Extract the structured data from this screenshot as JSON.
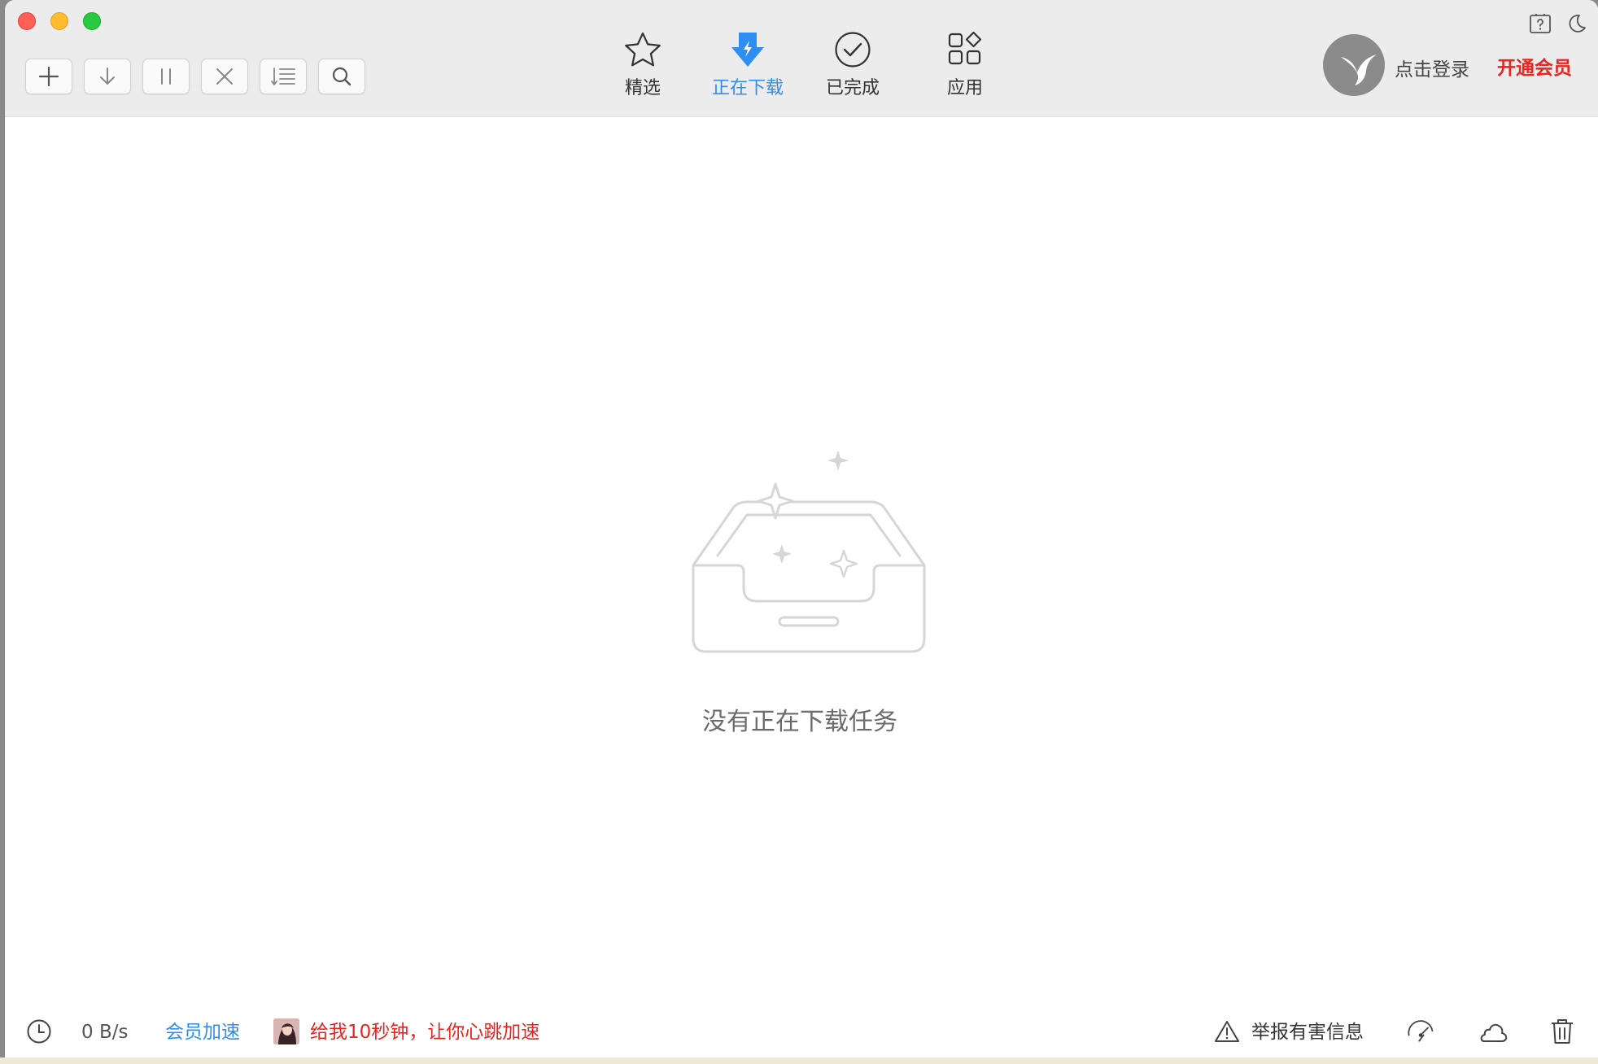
{
  "toolbar": {
    "buttons": [
      {
        "name": "add-task-button",
        "icon": "plus-icon"
      },
      {
        "name": "start-download-button",
        "icon": "arrow-down-icon"
      },
      {
        "name": "pause-button",
        "icon": "pause-icon"
      },
      {
        "name": "delete-task-button",
        "icon": "close-icon"
      },
      {
        "name": "sort-button",
        "icon": "sort-list-icon"
      },
      {
        "name": "search-button",
        "icon": "search-icon"
      }
    ]
  },
  "nav": {
    "tabs": [
      {
        "label": "精选",
        "icon": "star-icon",
        "active": false
      },
      {
        "label": "正在下载",
        "icon": "download-bolt-icon",
        "active": true
      },
      {
        "label": "已完成",
        "icon": "check-circle-icon",
        "active": false
      },
      {
        "label": "应用",
        "icon": "apps-grid-icon",
        "active": false
      }
    ]
  },
  "account": {
    "login_text": "点击登录",
    "vip_text": "开通会员",
    "help_icon": "help-icon",
    "theme_icon": "moon-icon"
  },
  "main": {
    "empty_message": "没有正在下载任务",
    "illustration": "empty-inbox-icon"
  },
  "status": {
    "speed": "0 B/s",
    "vip_speedup": "会员加速",
    "promo_text": "给我10秒钟，让你心跳加速",
    "report_text": "举报有害信息"
  },
  "colors": {
    "accent": "#2f8ef2",
    "vip_red": "#e8251f",
    "titlebar_bg": "#ececec"
  }
}
